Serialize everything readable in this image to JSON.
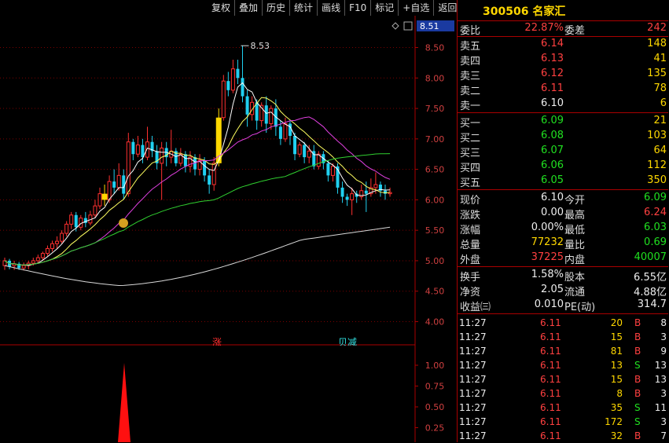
{
  "toolbar": [
    "复权",
    "叠加",
    "历史",
    "统计",
    "画线",
    "F10",
    "标记",
    "+自选",
    "返回"
  ],
  "stock": {
    "code": "300506",
    "name": "名家汇"
  },
  "main_chart": {
    "price_ticks": [
      "8.51",
      "8.50",
      "8.00",
      "7.50",
      "7.00",
      "6.50",
      "6.00",
      "5.50",
      "5.00",
      "4.50",
      "4.00"
    ],
    "current_price_tag": "8.51",
    "high_label": "8.53",
    "markers": {
      "up_marker": "涨",
      "down_marker": "贝减"
    }
  },
  "sub_chart": {
    "ticks": [
      "1.00",
      "0.75",
      "0.50",
      "0.25"
    ]
  },
  "chart_data": {
    "type": "candlestick",
    "y_range": [
      3.8,
      8.7
    ],
    "candles": [
      [
        4.92,
        5.0,
        4.85,
        5.05
      ],
      [
        5.0,
        4.9,
        4.86,
        5.03
      ],
      [
        4.92,
        4.95,
        4.85,
        5.0
      ],
      [
        4.95,
        4.88,
        4.85,
        4.98
      ],
      [
        4.88,
        4.92,
        4.84,
        4.97
      ],
      [
        4.92,
        4.96,
        4.86,
        5.0
      ],
      [
        4.96,
        5.0,
        4.92,
        5.05
      ],
      [
        5.0,
        5.05,
        4.96,
        5.1
      ],
      [
        5.05,
        5.12,
        5.0,
        5.15
      ],
      [
        5.12,
        5.2,
        5.08,
        5.25
      ],
      [
        5.2,
        5.28,
        5.15,
        5.33
      ],
      [
        5.28,
        5.32,
        5.2,
        5.4
      ],
      [
        5.32,
        5.45,
        5.28,
        5.5
      ],
      [
        5.45,
        5.6,
        5.4,
        5.65
      ],
      [
        5.6,
        5.75,
        5.52,
        5.8
      ],
      [
        5.75,
        5.55,
        5.48,
        5.8
      ],
      [
        5.55,
        5.7,
        5.5,
        5.75
      ],
      [
        5.7,
        5.62,
        5.55,
        5.8
      ],
      [
        5.62,
        5.75,
        5.58,
        5.82
      ],
      [
        5.75,
        5.9,
        5.7,
        6.0
      ],
      [
        5.9,
        6.1,
        5.85,
        6.2
      ],
      [
        6.1,
        6.0,
        5.9,
        6.25
      ],
      [
        6.0,
        6.3,
        5.95,
        6.4
      ],
      [
        6.3,
        6.2,
        6.1,
        6.5
      ],
      [
        6.2,
        6.4,
        6.15,
        6.6
      ],
      [
        6.4,
        6.1,
        6.0,
        6.5
      ],
      [
        6.1,
        6.95,
        6.05,
        7.1
      ],
      [
        6.95,
        6.75,
        6.65,
        7.0
      ],
      [
        6.75,
        6.9,
        6.7,
        7.05
      ],
      [
        6.9,
        6.7,
        6.6,
        7.0
      ],
      [
        6.7,
        6.95,
        6.65,
        7.2
      ],
      [
        6.95,
        6.8,
        6.7,
        7.05
      ],
      [
        6.8,
        6.6,
        6.5,
        6.9
      ],
      [
        6.6,
        6.85,
        6.0,
        6.95
      ],
      [
        6.85,
        6.7,
        6.55,
        6.95
      ],
      [
        6.7,
        6.8,
        6.6,
        7.15
      ],
      [
        6.8,
        6.6,
        6.55,
        6.85
      ],
      [
        6.6,
        6.75,
        6.55,
        6.85
      ],
      [
        6.75,
        6.55,
        6.45,
        6.8
      ],
      [
        6.55,
        6.7,
        6.45,
        6.8
      ],
      [
        6.7,
        6.5,
        6.4,
        6.75
      ],
      [
        6.5,
        6.65,
        6.4,
        6.75
      ],
      [
        6.65,
        6.4,
        6.3,
        6.7
      ],
      [
        6.4,
        6.25,
        6.1,
        6.5
      ],
      [
        6.25,
        6.6,
        6.15,
        6.7
      ],
      [
        6.6,
        7.35,
        6.55,
        7.5
      ],
      [
        7.35,
        7.95,
        7.3,
        8.05
      ],
      [
        7.95,
        7.8,
        7.7,
        8.1
      ],
      [
        7.8,
        8.15,
        7.75,
        8.3
      ],
      [
        8.15,
        8.0,
        7.9,
        8.3
      ],
      [
        8.0,
        7.7,
        7.6,
        8.53
      ],
      [
        7.7,
        7.4,
        7.2,
        7.8
      ],
      [
        7.4,
        7.6,
        7.3,
        7.7
      ],
      [
        7.6,
        7.3,
        7.15,
        7.65
      ],
      [
        7.3,
        7.55,
        7.2,
        7.6
      ],
      [
        7.55,
        7.25,
        7.1,
        7.7
      ],
      [
        7.25,
        7.5,
        7.15,
        7.55
      ],
      [
        7.5,
        7.2,
        7.05,
        7.65
      ],
      [
        7.2,
        7.0,
        6.9,
        7.3
      ],
      [
        7.0,
        7.25,
        6.95,
        7.35
      ],
      [
        7.25,
        7.05,
        6.9,
        7.3
      ],
      [
        7.05,
        6.75,
        6.65,
        7.1
      ],
      [
        6.75,
        6.9,
        6.7,
        6.95
      ],
      [
        6.9,
        6.7,
        6.6,
        6.95
      ],
      [
        6.7,
        6.8,
        6.6,
        6.9
      ],
      [
        6.8,
        6.55,
        6.5,
        6.9
      ],
      [
        6.55,
        6.75,
        6.5,
        6.8
      ],
      [
        6.75,
        6.6,
        6.5,
        6.8
      ],
      [
        6.6,
        6.4,
        6.3,
        6.65
      ],
      [
        6.4,
        6.55,
        6.3,
        6.6
      ],
      [
        6.55,
        6.2,
        6.1,
        6.6
      ],
      [
        6.2,
        6.05,
        5.95,
        6.3
      ],
      [
        6.05,
        6.0,
        5.9,
        6.1
      ],
      [
        6.0,
        6.1,
        5.75,
        6.2
      ],
      [
        6.1,
        6.05,
        5.95,
        6.15
      ],
      [
        6.05,
        6.15,
        6.0,
        6.25
      ],
      [
        6.15,
        6.1,
        5.8,
        6.3
      ],
      [
        6.1,
        6.2,
        6.05,
        6.35
      ],
      [
        6.2,
        6.25,
        6.1,
        6.45
      ],
      [
        6.25,
        6.15,
        6.05,
        6.3
      ],
      [
        6.15,
        6.1,
        6.0,
        6.25
      ],
      [
        6.1,
        6.12,
        6.05,
        6.2
      ]
    ],
    "highlight_candles": [
      21,
      45
    ]
  },
  "quote": {
    "weibi": {
      "label": "委比",
      "value": "22.87%",
      "label2": "委差",
      "value2": "242"
    },
    "asks": [
      {
        "label": "卖五",
        "price": "6.14",
        "vol": "148"
      },
      {
        "label": "卖四",
        "price": "6.13",
        "vol": "41"
      },
      {
        "label": "卖三",
        "price": "6.12",
        "vol": "135"
      },
      {
        "label": "卖二",
        "price": "6.11",
        "vol": "78"
      },
      {
        "label": "卖一",
        "price": "6.10",
        "vol": "6"
      }
    ],
    "bids": [
      {
        "label": "买一",
        "price": "6.09",
        "vol": "21"
      },
      {
        "label": "买二",
        "price": "6.08",
        "vol": "103"
      },
      {
        "label": "买三",
        "price": "6.07",
        "vol": "64"
      },
      {
        "label": "买四",
        "price": "6.06",
        "vol": "112"
      },
      {
        "label": "买五",
        "price": "6.05",
        "vol": "350"
      }
    ],
    "stats": [
      {
        "l1": "现价",
        "v1": "6.10",
        "l2": "今开",
        "v2": "6.09"
      },
      {
        "l1": "涨跌",
        "v1": "0.00",
        "l2": "最高",
        "v2": "6.24"
      },
      {
        "l1": "涨幅",
        "v1": "0.00%",
        "l2": "最低",
        "v2": "6.03"
      },
      {
        "l1": "总量",
        "v1": "77232",
        "l2": "量比",
        "v2": "0.69"
      },
      {
        "l1": "外盘",
        "v1": "37225",
        "l2": "内盘",
        "v2": "40007"
      }
    ],
    "fin": [
      {
        "l1": "换手",
        "v1": "1.58%",
        "l2": "股本",
        "v2": "6.55亿"
      },
      {
        "l1": "净资",
        "v1": "2.05",
        "l2": "流通",
        "v2": "4.88亿"
      },
      {
        "l1": "收益㈢",
        "v1": "0.010",
        "l2": "PE(动)",
        "v2": "314.7"
      }
    ]
  },
  "trades": [
    {
      "time": "11:27",
      "price": "6.11",
      "vol": "20",
      "dir": "B",
      "n": "8"
    },
    {
      "time": "11:27",
      "price": "6.11",
      "vol": "15",
      "dir": "B",
      "n": "3"
    },
    {
      "time": "11:27",
      "price": "6.11",
      "vol": "81",
      "dir": "B",
      "n": "9"
    },
    {
      "time": "11:27",
      "price": "6.11",
      "vol": "13",
      "dir": "S",
      "n": "13"
    },
    {
      "time": "11:27",
      "price": "6.11",
      "vol": "15",
      "dir": "B",
      "n": "13"
    },
    {
      "time": "11:27",
      "price": "6.11",
      "vol": "8",
      "dir": "B",
      "n": "3"
    },
    {
      "time": "11:27",
      "price": "6.11",
      "vol": "35",
      "dir": "S",
      "n": "11"
    },
    {
      "time": "11:27",
      "price": "6.11",
      "vol": "172",
      "dir": "S",
      "n": "3"
    },
    {
      "time": "11:27",
      "price": "6.11",
      "vol": "32",
      "dir": "B",
      "n": "7"
    }
  ],
  "colors": {
    "up": "#ff3030",
    "down": "#20d0f0",
    "highlight": "#ffd800",
    "bg": "#000000",
    "grid": "#8b0000"
  }
}
